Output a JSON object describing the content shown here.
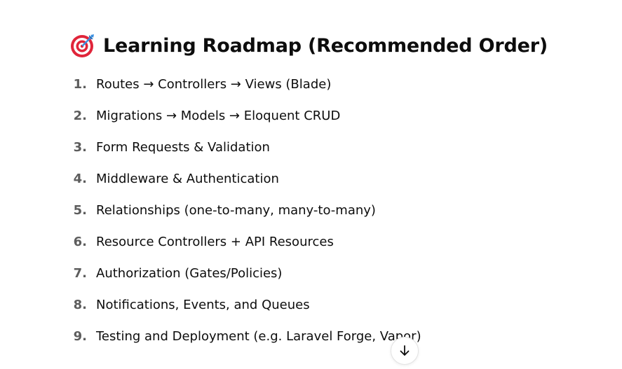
{
  "heading": {
    "icon": "direct-hit-target-icon",
    "text": "Learning Roadmap (Recommended Order)"
  },
  "roadmap": [
    {
      "number": "1.",
      "text": "Routes → Controllers → Views (Blade)"
    },
    {
      "number": "2.",
      "text": "Migrations → Models → Eloquent CRUD"
    },
    {
      "number": "3.",
      "text": "Form Requests & Validation"
    },
    {
      "number": "4.",
      "text": "Middleware & Authentication"
    },
    {
      "number": "5.",
      "text": "Relationships (one-to-many, many-to-many)"
    },
    {
      "number": "6.",
      "text": "Resource Controllers + API Resources"
    },
    {
      "number": "7.",
      "text": "Authorization (Gates/Policies)"
    },
    {
      "number": "8.",
      "text": "Notifications, Events, and Queues"
    },
    {
      "number": "9.",
      "text": "Testing and Deployment (e.g. Laravel Forge, Vapor)"
    }
  ],
  "scroll_button": {
    "icon": "arrow-down-icon"
  },
  "colors": {
    "text": "#0d0d0d",
    "number": "#5d5d5d",
    "target_red": "#e0253a",
    "dart_blue": "#3b8fe0"
  }
}
